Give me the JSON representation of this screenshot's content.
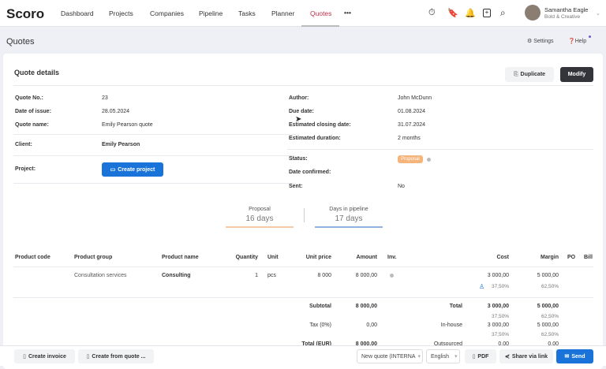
{
  "header": {
    "logo": "Scoro",
    "nav": [
      "Dashboard",
      "Projects",
      "Companies",
      "Pipeline",
      "Tasks",
      "Planner",
      "Quotes"
    ],
    "active": "Quotes",
    "more": "•••",
    "user": {
      "name": "Samantha Eagle",
      "company": "Bold & Creative"
    }
  },
  "page": {
    "title": "Quotes",
    "settings": "Settings",
    "help": "Help"
  },
  "card": {
    "title": "Quote details",
    "duplicate": "Duplicate",
    "modify": "Modify"
  },
  "left": {
    "quote_no_label": "Quote No.:",
    "quote_no": "23",
    "date_label": "Date of issue:",
    "date": "28.05.2024",
    "name_label": "Quote name:",
    "name": "Emily Pearson quote",
    "client_label": "Client:",
    "client": "Emily Pearson",
    "project_label": "Project:",
    "create_project": "Create project"
  },
  "right": {
    "author_label": "Author:",
    "author": "John McDunn",
    "due_label": "Due date:",
    "due": "01.08.2024",
    "closing_label": "Estimated closing date:",
    "closing": "31.07.2024",
    "duration_label": "Estimated duration:",
    "duration": "2 months",
    "status_label": "Status:",
    "status": "Proposal",
    "confirmed_label": "Date confirmed:",
    "sent_label": "Sent:",
    "sent": "No"
  },
  "summary": {
    "stage_label": "Proposal",
    "stage_value": "16 days",
    "pipeline_label": "Days in pipeline",
    "pipeline_value": "17 days"
  },
  "table": {
    "headers": [
      "Product code",
      "Product group",
      "Product name",
      "Quantity",
      "Unit",
      "Unit price",
      "Amount",
      "Inv.",
      "Cost",
      "Margin",
      "PO",
      "Bill"
    ],
    "row": {
      "group": "Consultation services",
      "name": "Consulting",
      "qty": "1",
      "unit": "pcs",
      "price": "8 000",
      "amount": "8 000,00",
      "cost": "3 000,00",
      "cost_pct": "37,50%",
      "margin": "5 000,00",
      "margin_pct": "62,50%"
    }
  },
  "totals": {
    "subtotal_label": "Subtotal",
    "subtotal": "8 000,00",
    "tax_label": "Tax (0%)",
    "tax": "0,00",
    "total_label": "Total (EUR)",
    "total": "8 000,00",
    "total2_label": "Total",
    "total_cost": "3 000,00",
    "total_cost_pct": "37,50%",
    "total_margin": "5 000,00",
    "total_margin_pct": "62,50%",
    "inhouse_label": "In-house",
    "inhouse_cost": "3 000,00",
    "inhouse_cost_pct": "37,50%",
    "inhouse_margin": "5 000,00",
    "inhouse_margin_pct": "62,50%",
    "outsourced_label": "Outsourced",
    "outsourced_cost": "0,00",
    "outsourced_margin": "0,00"
  },
  "footer": {
    "create_invoice": "Create invoice",
    "create_from": "Create from quote ...",
    "template": "New quote (INTERNA",
    "language": "English",
    "pdf": "PDF",
    "share": "Share via link",
    "send": "Send"
  },
  "colors": {
    "accent": "#c0304a",
    "primary": "#1a73d9",
    "status": "#f5b47a",
    "dark": "#33353b"
  }
}
